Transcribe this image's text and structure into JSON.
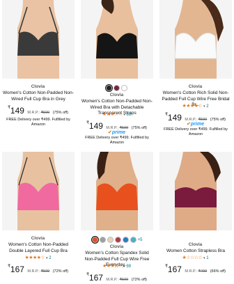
{
  "products": [
    {
      "brand": "Clovia",
      "title": "Women's Cotton Non-Padded Non-Wired Full Cup Bra in Grey",
      "price_symbol": "₹",
      "price": "149",
      "mrp_label": "M.R.P.:",
      "mrp": "₹599",
      "discount": "(75% off)",
      "delivery": "FREE Delivery over ₹499. Fulfilled by Amazon"
    },
    {
      "brand": "Clovia",
      "title": "Women's Cotton Non-Padded Non-Wired Bra with Detachable Transparent Straps",
      "stars": "★★★☆☆",
      "rating_count": "88",
      "price_symbol": "₹",
      "price": "149",
      "mrp_label": "M.R.P.:",
      "mrp": "₹599",
      "discount": "(75% off)",
      "prime": "prime",
      "delivery": "FREE Delivery over ₹499. Fulfilled by Amazon",
      "swatch_colors": [
        "#222222",
        "#7b2140",
        "#ffffff"
      ]
    },
    {
      "brand": "Clovia",
      "title": "Women's Cotton Rich Solid Non-Padded Full Cup Wire Free Bridal Br...",
      "stars": "★★★★☆",
      "rating_count": "2",
      "price_symbol": "₹",
      "price": "149",
      "mrp_label": "M.R.P.:",
      "mrp": "₹599",
      "discount": "(75% off)",
      "prime": "prime",
      "delivery": "FREE Delivery over ₹499. Fulfilled by Amazon"
    },
    {
      "brand": "Clovia",
      "title": "Women's Cotton Non-Padded Double Layered Full Cup Bra",
      "stars": "★★★★☆",
      "rating_count": "2",
      "price_symbol": "₹",
      "price": "167",
      "mrp_label": "M.R.P.:",
      "mrp": "₹599",
      "discount": "(72% off)"
    },
    {
      "brand": "Clovia",
      "title": "Women's Cotton Spandex Solid Non-Padded Full Cup Wire Free Everyday...",
      "stars": "★★★½☆",
      "rating_count": "39",
      "price_symbol": "₹",
      "price": "167",
      "mrp_label": "M.R.P.:",
      "mrp": "₹599",
      "discount": "(72% off)",
      "swatch_colors": [
        "#e8501e",
        "#9e9e9e",
        "#e6d2b8",
        "#b23a4a",
        "#2b7bbf",
        "#49b0c8"
      ],
      "swatch_more": "+5"
    },
    {
      "brand": "Clovia",
      "title": "Women Cotton Strapless Bra",
      "stars": "★☆☆☆☆",
      "rating_count": "1",
      "price_symbol": "₹",
      "price": "167",
      "mrp_label": "M.R.P.:",
      "mrp": "₹499",
      "discount": "(66% off)"
    }
  ],
  "colors": {
    "star": "#de7921",
    "link": "#007185",
    "prime": "#1a98ff"
  }
}
